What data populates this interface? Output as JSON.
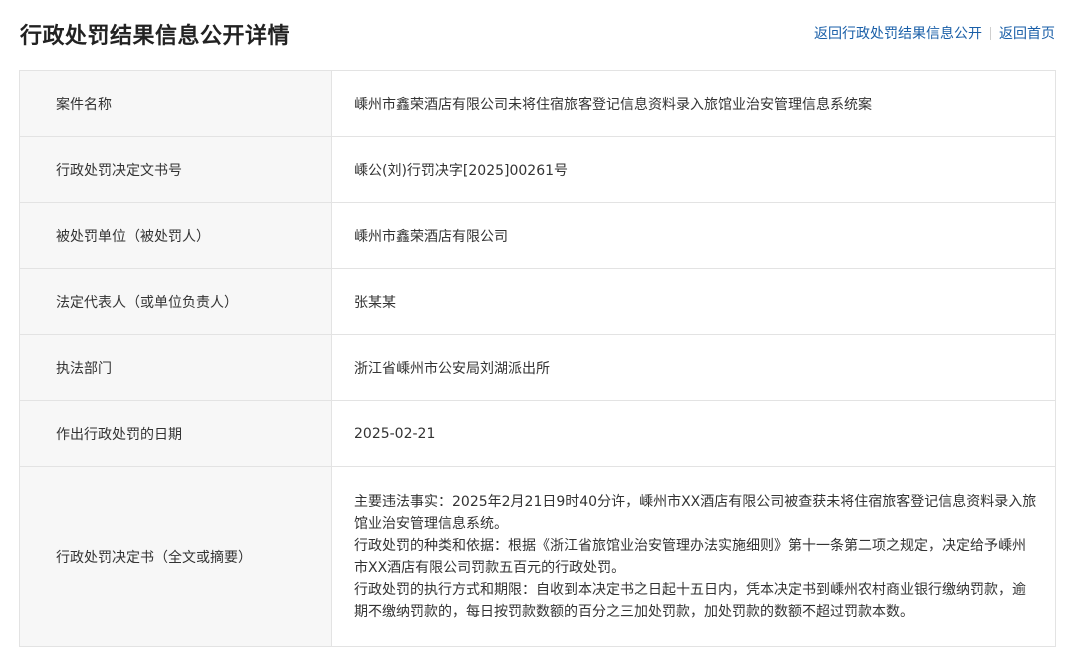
{
  "header": {
    "title": "行政处罚结果信息公开详情",
    "links": {
      "back_list": "返回行政处罚结果信息公开",
      "back_home": "返回首页"
    }
  },
  "rows": [
    {
      "label": "案件名称",
      "value": "嵊州市鑫荣酒店有限公司未将住宿旅客登记信息资料录入旅馆业治安管理信息系统案"
    },
    {
      "label": "行政处罚决定文书号",
      "value": "嵊公(刘)行罚决字[2025]00261号"
    },
    {
      "label": "被处罚单位（被处罚人）",
      "value": "嵊州市鑫荣酒店有限公司"
    },
    {
      "label": "法定代表人（或单位负责人）",
      "value": "张某某"
    },
    {
      "label": "执法部门",
      "value": "浙江省嵊州市公安局刘湖派出所"
    },
    {
      "label": "作出行政处罚的日期",
      "value": "2025-02-21"
    },
    {
      "label": "行政处罚决定书（全文或摘要）",
      "paragraphs": [
        "主要违法事实：2025年2月21日9时40分许，嵊州市XX酒店有限公司被查获未将住宿旅客登记信息资料录入旅馆业治安管理信息系统。",
        "行政处罚的种类和依据：根据《浙江省旅馆业治安管理办法实施细则》第十一条第二项之规定，决定给予嵊州市XX酒店有限公司罚款五百元的行政处罚。",
        "行政处罚的执行方式和期限：自收到本决定书之日起十五日内，凭本决定书到嵊州农村商业银行缴纳罚款，逾期不缴纳罚款的，每日按罚款数额的百分之三加处罚款，加处罚款的数额不超过罚款本数。"
      ]
    }
  ]
}
